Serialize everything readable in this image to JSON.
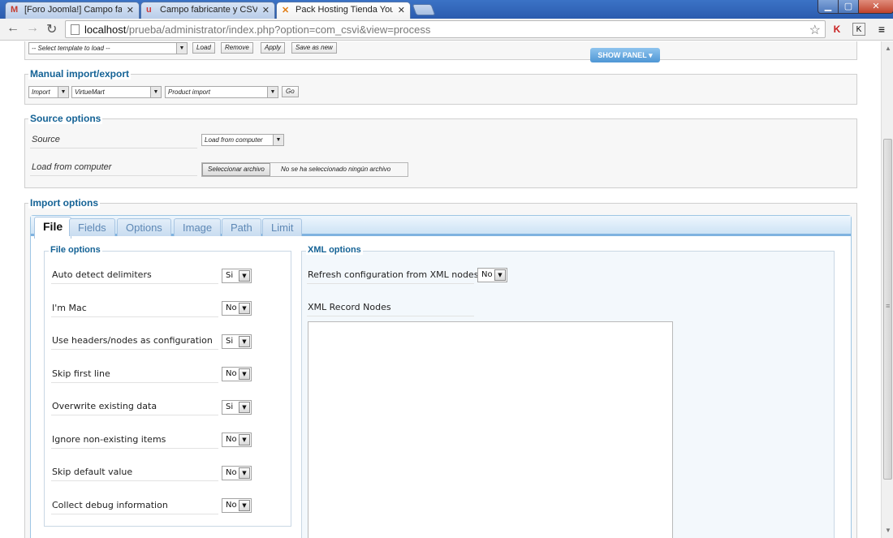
{
  "browser": {
    "tabs": [
      {
        "icon": "M",
        "label": "[Foro Joomla!] Campo fab",
        "active": false
      },
      {
        "icon": "u",
        "label": "Campo fabricante y CSVI",
        "active": false
      },
      {
        "icon": "✕",
        "label": "Pack Hosting Tienda Your",
        "active": true
      }
    ],
    "url_host": "localhost",
    "url_path": "/prueba/administrator/index.php?option=com_csvi&view=process"
  },
  "template_bar": {
    "select_placeholder": "-- Select template to load --",
    "buttons": [
      "Load",
      "Remove",
      "Apply",
      "Save as new"
    ],
    "show_panel": "SHOW PANEL"
  },
  "manual": {
    "legend": "Manual import/export",
    "action": "Import",
    "component": "VirtueMart",
    "operation": "Product import",
    "go": "Go"
  },
  "source": {
    "legend": "Source options",
    "source_label": "Source",
    "source_value": "Load from computer",
    "computer_label": "Load from computer",
    "file_button": "Seleccionar archivo",
    "file_status": "No se ha seleccionado ningún archivo"
  },
  "import_options": {
    "legend": "Import options",
    "tabs": [
      "File",
      "Fields",
      "Options",
      "Image",
      "Path",
      "Limit"
    ],
    "file_options": {
      "legend": "File options",
      "rows": [
        {
          "label": "Auto detect delimiters",
          "value": "Si"
        },
        {
          "label": "I'm Mac",
          "value": "No"
        },
        {
          "label": "Use headers/nodes as configuration",
          "value": "Si"
        },
        {
          "label": "Skip first line",
          "value": "No"
        },
        {
          "label": "Overwrite existing data",
          "value": "Si"
        },
        {
          "label": "Ignore non-existing items",
          "value": "No"
        },
        {
          "label": "Skip default value",
          "value": "No"
        },
        {
          "label": "Collect debug information",
          "value": "No"
        }
      ]
    },
    "xml_options": {
      "legend": "XML options",
      "refresh_label": "Refresh configuration from XML nodes",
      "refresh_value": "No",
      "record_nodes_label": "XML Record Nodes"
    }
  }
}
